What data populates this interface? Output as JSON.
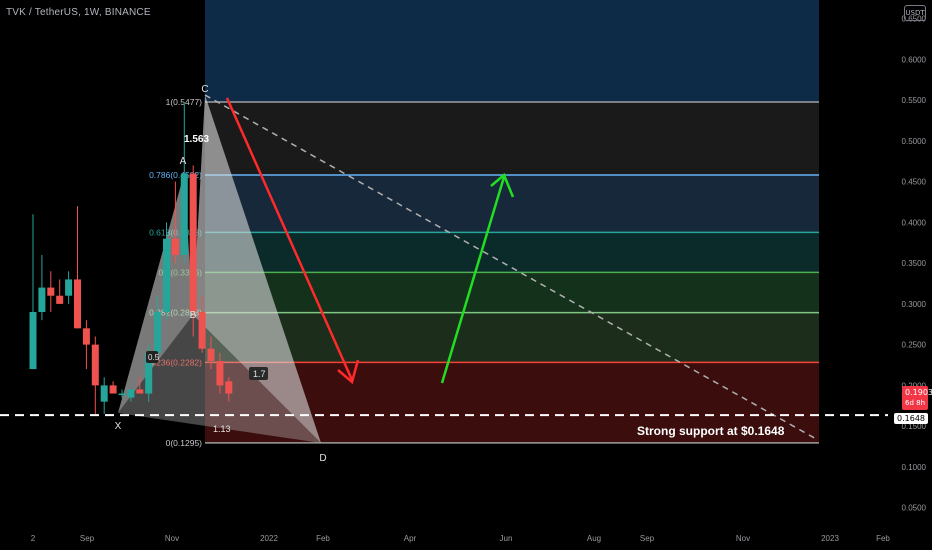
{
  "header": {
    "title": "TVK / TetherUS, 1W, BINANCE",
    "currency": "USDT"
  },
  "annotations": {
    "support_text": "Strong support at $0.1648",
    "price_tag_value": "0.1903",
    "price_tag_countdown": "6d 8h",
    "support_tag": "0.1648"
  },
  "colors": {
    "background": "#000000",
    "up_candle": "#26a69a",
    "down_candle": "#ef5350",
    "arrow_down": "#ff2a2a",
    "arrow_up": "#22dd22",
    "fib_786": "#64b5f6",
    "fib_618": "#26a69a",
    "fib_5": "#4caf50",
    "fib_382": "#81c784",
    "fib_236": "#f44336"
  },
  "chart_data": {
    "type": "candlestick",
    "symbol": "TVK / TetherUS",
    "timeframe": "1W",
    "exchange": "BINANCE",
    "y_axis": {
      "ticks": [
        "0.6500",
        "0.6000",
        "0.5500",
        "0.5000",
        "0.4500",
        "0.4000",
        "0.3500",
        "0.3000",
        "0.2500",
        "0.2000",
        "0.1500",
        "0.1000",
        "0.0500"
      ],
      "ylim": [
        0.0,
        0.66
      ],
      "position": "right"
    },
    "x_axis": {
      "ticks": [
        "2",
        "Sep",
        "Nov",
        "2022",
        "Feb",
        "Apr",
        "Jun",
        "Aug",
        "Sep",
        "Nov",
        "2023",
        "Feb"
      ]
    },
    "current_price": 0.1903,
    "support_level": 0.1648,
    "fib_retracement": {
      "levels": [
        {
          "label": "1(0.5477)",
          "value": 0.5477
        },
        {
          "label": "0.786(0.4582)",
          "value": 0.4582
        },
        {
          "label": "0.618(0.3878)",
          "value": 0.3878
        },
        {
          "label": "0.5(0.3386)",
          "value": 0.3386
        },
        {
          "label": "0.382(0.2893)",
          "value": 0.2893
        },
        {
          "label": "0.236(0.2282)",
          "value": 0.2282
        },
        {
          "label": "0(0.1295)",
          "value": 0.1295
        }
      ]
    },
    "harmonic_pattern": {
      "points": [
        {
          "label": "X",
          "value": 0.165
        },
        {
          "label": "A",
          "value": 0.46
        },
        {
          "label": "B",
          "value": 0.29
        },
        {
          "label": "C",
          "value": 0.5477
        },
        {
          "label": "D",
          "value": 0.1295
        }
      ],
      "ratios": [
        "1.563",
        "1.7",
        "1.13",
        "0.5"
      ]
    },
    "candles": [
      {
        "o": 0.22,
        "h": 0.41,
        "l": 0.22,
        "c": 0.29
      },
      {
        "o": 0.29,
        "h": 0.36,
        "l": 0.28,
        "c": 0.32
      },
      {
        "o": 0.32,
        "h": 0.34,
        "l": 0.29,
        "c": 0.31
      },
      {
        "o": 0.31,
        "h": 0.33,
        "l": 0.3,
        "c": 0.3
      },
      {
        "o": 0.31,
        "h": 0.34,
        "l": 0.3,
        "c": 0.33
      },
      {
        "o": 0.33,
        "h": 0.42,
        "l": 0.27,
        "c": 0.27
      },
      {
        "o": 0.27,
        "h": 0.28,
        "l": 0.22,
        "c": 0.25
      },
      {
        "o": 0.25,
        "h": 0.26,
        "l": 0.165,
        "c": 0.2
      },
      {
        "o": 0.18,
        "h": 0.21,
        "l": 0.165,
        "c": 0.2
      },
      {
        "o": 0.2,
        "h": 0.205,
        "l": 0.19,
        "c": 0.19
      },
      {
        "o": 0.19,
        "h": 0.195,
        "l": 0.185,
        "c": 0.19
      },
      {
        "o": 0.185,
        "h": 0.195,
        "l": 0.18,
        "c": 0.195
      },
      {
        "o": 0.195,
        "h": 0.21,
        "l": 0.19,
        "c": 0.19
      },
      {
        "o": 0.19,
        "h": 0.25,
        "l": 0.18,
        "c": 0.24
      },
      {
        "o": 0.24,
        "h": 0.31,
        "l": 0.23,
        "c": 0.29
      },
      {
        "o": 0.29,
        "h": 0.4,
        "l": 0.28,
        "c": 0.38
      },
      {
        "o": 0.38,
        "h": 0.45,
        "l": 0.35,
        "c": 0.36
      },
      {
        "o": 0.36,
        "h": 0.547,
        "l": 0.35,
        "c": 0.46
      },
      {
        "o": 0.46,
        "h": 0.47,
        "l": 0.26,
        "c": 0.29
      },
      {
        "o": 0.29,
        "h": 0.31,
        "l": 0.24,
        "c": 0.245
      },
      {
        "o": 0.245,
        "h": 0.26,
        "l": 0.22,
        "c": 0.23
      },
      {
        "o": 0.23,
        "h": 0.24,
        "l": 0.19,
        "c": 0.2
      },
      {
        "o": 0.205,
        "h": 0.21,
        "l": 0.18,
        "c": 0.19
      }
    ]
  }
}
